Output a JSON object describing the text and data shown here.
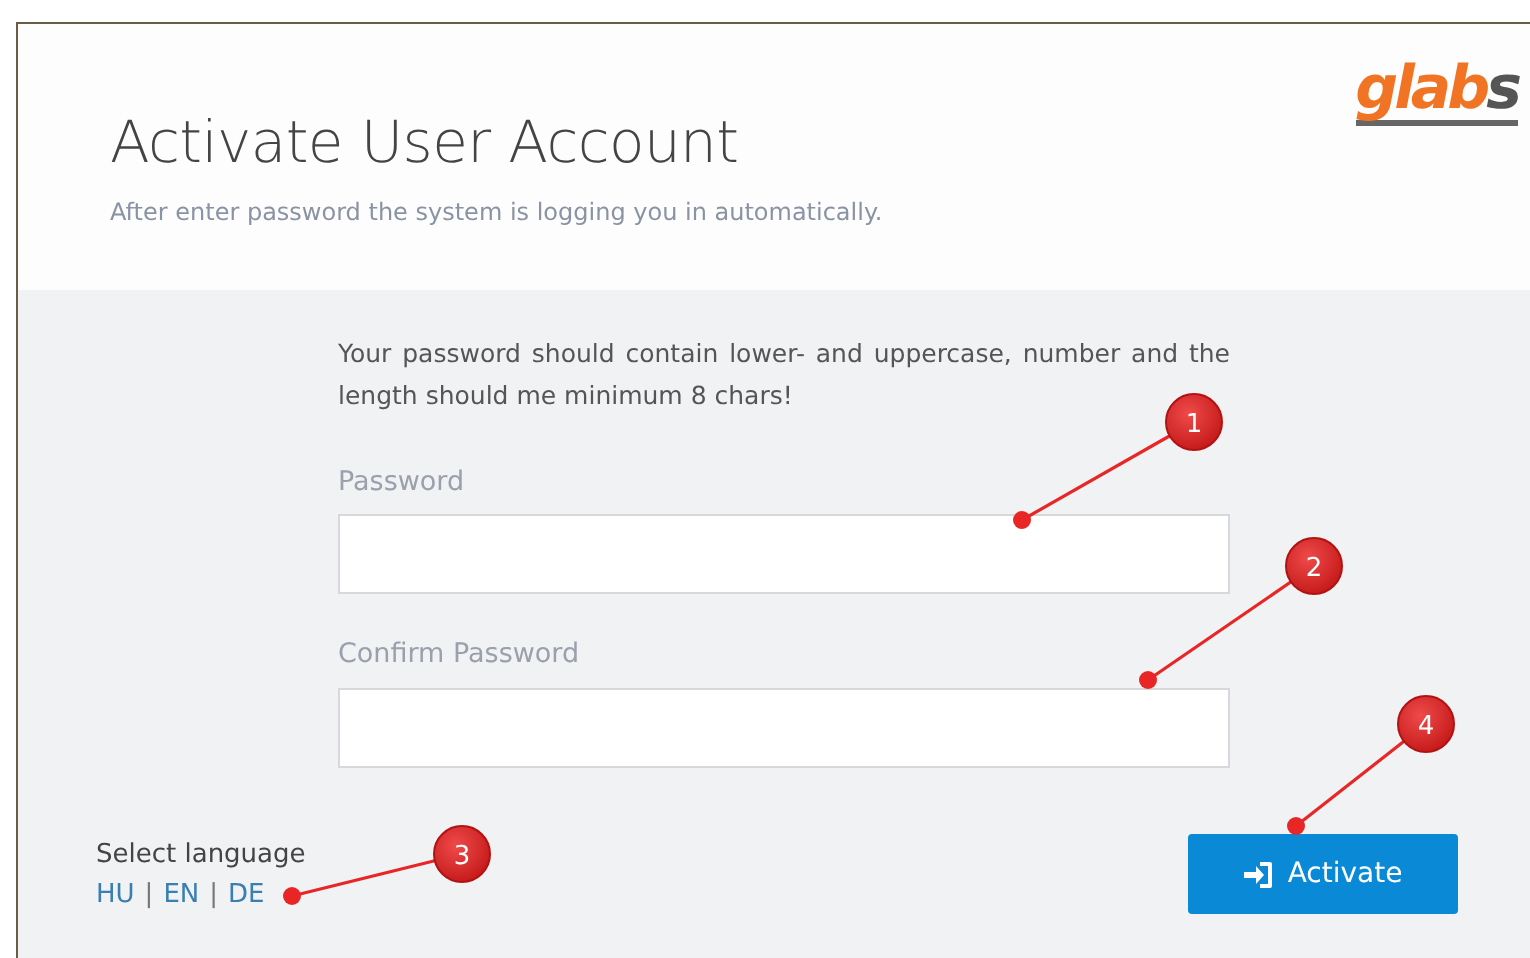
{
  "header": {
    "title": "Activate User Account",
    "subtitle": "After enter password the system is logging you in automatically.",
    "logo": {
      "main": "glab",
      "tail": "s"
    }
  },
  "form": {
    "hint": "Your password should contain lower- and uppercase, number and the length should me minimum 8 chars!",
    "fields": [
      {
        "label": "Password"
      },
      {
        "label": "Confirm Password"
      }
    ],
    "language": {
      "label": "Select language",
      "options": [
        {
          "label": "HU"
        },
        {
          "label": "EN"
        },
        {
          "label": "DE"
        }
      ],
      "separator": "|"
    },
    "button": "Activate"
  },
  "annotations": [
    {
      "number": "1"
    },
    {
      "number": "2"
    },
    {
      "number": "3"
    },
    {
      "number": "4"
    }
  ]
}
